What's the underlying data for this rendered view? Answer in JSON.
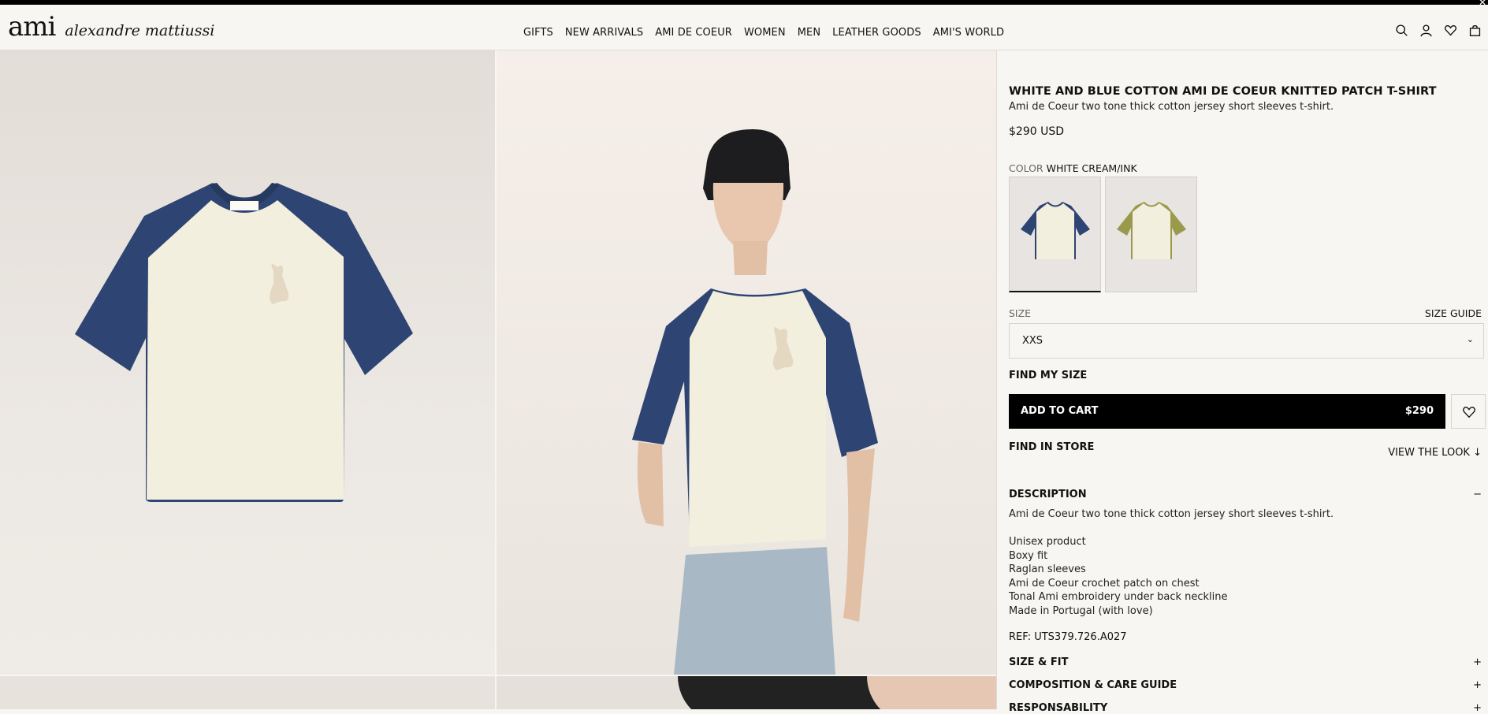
{
  "header": {
    "logo": "ami",
    "brand": "alexandre mattiussi",
    "nav": [
      "GIFTS",
      "NEW ARRIVALS",
      "AMI DE COEUR",
      "WOMEN",
      "MEN",
      "LEATHER GOODS",
      "AMI'S WORLD"
    ],
    "icons": [
      "search-icon",
      "account-icon",
      "wishlist-icon",
      "bag-icon"
    ]
  },
  "product": {
    "title": "WHITE AND BLUE COTTON AMI DE COEUR KNITTED PATCH T-SHIRT",
    "subtitle": "Ami de Coeur two tone thick cotton jersey short sleeves t-shirt.",
    "price": "$290 USD",
    "color_label": "COLOR",
    "color_value": "WHITE CREAM/INK",
    "swatch_colors": [
      "#2e4473",
      "#9a9a4c"
    ],
    "size_label": "SIZE",
    "size_guide": "SIZE GUIDE",
    "size_value": "XXS",
    "find_my_size": "FIND MY SIZE",
    "add_to_cart": "ADD TO CART",
    "cart_price": "$290",
    "find_in_store": "FIND IN STORE",
    "view_the_look": "VIEW THE LOOK",
    "description": {
      "heading": "DESCRIPTION",
      "intro": "Ami de Coeur two tone thick cotton jersey short sleeves t-shirt.",
      "features": [
        "Unisex product",
        "Boxy fit",
        "Raglan sleeves",
        "Ami de Coeur crochet patch on chest",
        "Tonal Ami embroidery under back neckline",
        "Made in Portugal (with love)"
      ],
      "ref": "REF: UTS379.726.A027"
    },
    "accordions": [
      "SIZE & FIT",
      "COMPOSITION & CARE GUIDE",
      "RESPONSABILITY"
    ]
  },
  "colors": {
    "sleeve": "#2e4473",
    "body": "#f3efdf",
    "black": "#000000"
  }
}
